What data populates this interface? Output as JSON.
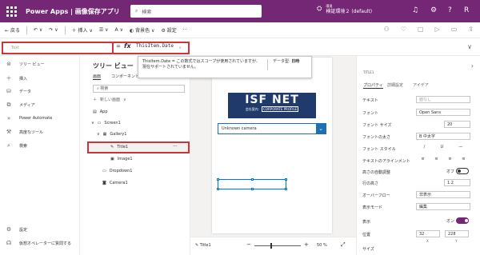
{
  "topbar": {
    "app_title": "Power Apps | 画像保存アプリ",
    "search_placeholder": "検索",
    "env_label": "環境",
    "env_name": "検証環境２ (default)",
    "help_glyph": "?",
    "avatar_text": "R"
  },
  "cmdbar": {
    "back": "戻る",
    "insert": "挿入",
    "color_glyph": "A",
    "background": "背景色",
    "settings": "設定"
  },
  "formula": {
    "property": "Text",
    "eq": "=",
    "fx": "fx",
    "expression": "ThisItem.Date"
  },
  "tooltip": {
    "message": "ThisItem.Date = この数式ではスコープが使用されていますが、現在サポートされていません。",
    "datatype_label": "データ型:",
    "datatype_value": "日時"
  },
  "leftnav": {
    "items": [
      "ツリー ビュー",
      "挿入",
      "データ",
      "メディア",
      "Power Automate",
      "高度なツール",
      "検索"
    ],
    "bottom": [
      "設定",
      "仮想オペレーターに質問する"
    ]
  },
  "tree": {
    "title": "ツリー ビュー",
    "tabs": [
      "画面",
      "コンポーネント"
    ],
    "search_placeholder": "検索",
    "new_screen": "新しい画面",
    "items": [
      "App",
      "Screen1",
      "Gallery1",
      "Title1",
      "Image1",
      "Dropdown1",
      "Camera1"
    ],
    "selected": "Title1",
    "more": "···"
  },
  "canvas": {
    "logo_main": "ISF NET",
    "logo_sub": "会社案内",
    "logo_tag": "CORPORATE PROFILE",
    "dropdown_value": "Unknown camera"
  },
  "footer": {
    "item": "Title1",
    "zoom": "50 %"
  },
  "props": {
    "label_title": "TITLE1",
    "tabs": [
      "プロパティ",
      "詳細設定",
      "アイデア"
    ],
    "rows": [
      {
        "label": "テキスト",
        "value": "値なし"
      },
      {
        "label": "フォント",
        "value": "Open Sans"
      },
      {
        "label": "フォント サイズ",
        "value": "20"
      },
      {
        "label": "フォントの太さ",
        "value": "B 中太字"
      },
      {
        "label": "フォント スタイル",
        "value": ""
      },
      {
        "label": "テキストのアラインメント",
        "value": ""
      },
      {
        "label": "高さの自動調整",
        "value": "オフ"
      },
      {
        "label": "行の高さ",
        "value": "1.2"
      },
      {
        "label": "オーバーフロー",
        "value": "非表示"
      },
      {
        "label": "表示モード",
        "value": "編集"
      },
      {
        "label": "表示",
        "value": "オン"
      },
      {
        "label": "位置",
        "value": "32"
      },
      {
        "label": "サイズ",
        "value": ""
      }
    ],
    "pos_y": "228",
    "axis_x": "X",
    "axis_y": "Y"
  },
  "colors": {
    "brand": "#742774",
    "accent": "#0078d4",
    "error": "#d13438"
  }
}
